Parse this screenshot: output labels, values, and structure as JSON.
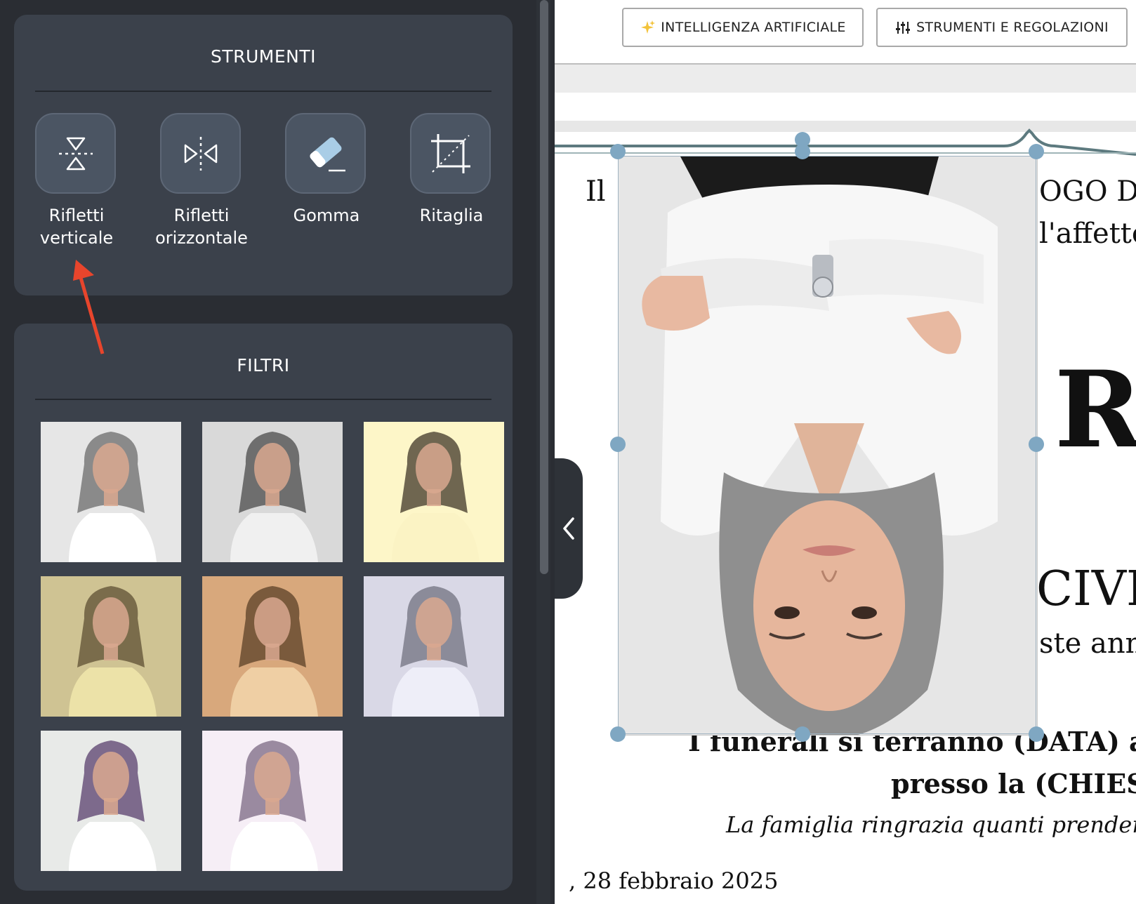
{
  "tools": {
    "title": "STRUMENTI",
    "items": [
      {
        "line1": "Rifletti",
        "line2": "verticale",
        "icon": "flip-vertical-icon"
      },
      {
        "line1": "Rifletti",
        "line2": "orizzontale",
        "icon": "flip-horizontal-icon"
      },
      {
        "line1": "Gomma",
        "line2": "",
        "icon": "eraser-icon"
      },
      {
        "line1": "Ritaglia",
        "line2": "",
        "icon": "crop-icon"
      }
    ]
  },
  "filters": {
    "title": "FILTRI",
    "items": [
      {
        "name": "original",
        "bg": "#e6e6e6",
        "tint": "#ffffff",
        "hair": "#8a8a8a"
      },
      {
        "name": "grayscale",
        "bg": "#d9d9d9",
        "tint": "#f0f0f0",
        "hair": "#6e6e6e"
      },
      {
        "name": "sepia-light",
        "bg": "#fdf6c8",
        "tint": "#fbf3c4",
        "hair": "#6f6650"
      },
      {
        "name": "olive",
        "bg": "#cfc393",
        "tint": "#ece2a8",
        "hair": "#7a6c4b"
      },
      {
        "name": "warm",
        "bg": "#d8a87c",
        "tint": "#efcfa4",
        "hair": "#7a5a3c"
      },
      {
        "name": "cool",
        "bg": "#d9d8e6",
        "tint": "#eeeef8",
        "hair": "#8b8b99"
      },
      {
        "name": "vivid",
        "bg": "#e8eae8",
        "tint": "#ffffff",
        "hair": "#7d6a8c"
      },
      {
        "name": "bright",
        "bg": "#f6eef6",
        "tint": "#ffffff",
        "hair": "#9a8aa0"
      }
    ]
  },
  "toolbar": {
    "ai_label": "INTELLIGENZA ARTIFICIALE",
    "tools_label": "STRUMENTI E REGOLAZIONI"
  },
  "document": {
    "line1_left": "Il",
    "line1_right": "OGO DI",
    "line2_right": "l'affetto",
    "big_letter": "R",
    "civil": "CIVIL",
    "annu": "ste annu",
    "funeral": "I funerali si terranno (DATA) all",
    "church": "presso la (CHIESA",
    "thanks": "La famiglia ringrazia quanti prenderann",
    "date": ", 28 febbraio 2025"
  },
  "colors": {
    "panel_bg": "#2a2d33",
    "card_bg": "#3b414b",
    "tool_btn": "#4b5563",
    "handle": "#7fa7c2",
    "arrow": "#e8452c"
  }
}
